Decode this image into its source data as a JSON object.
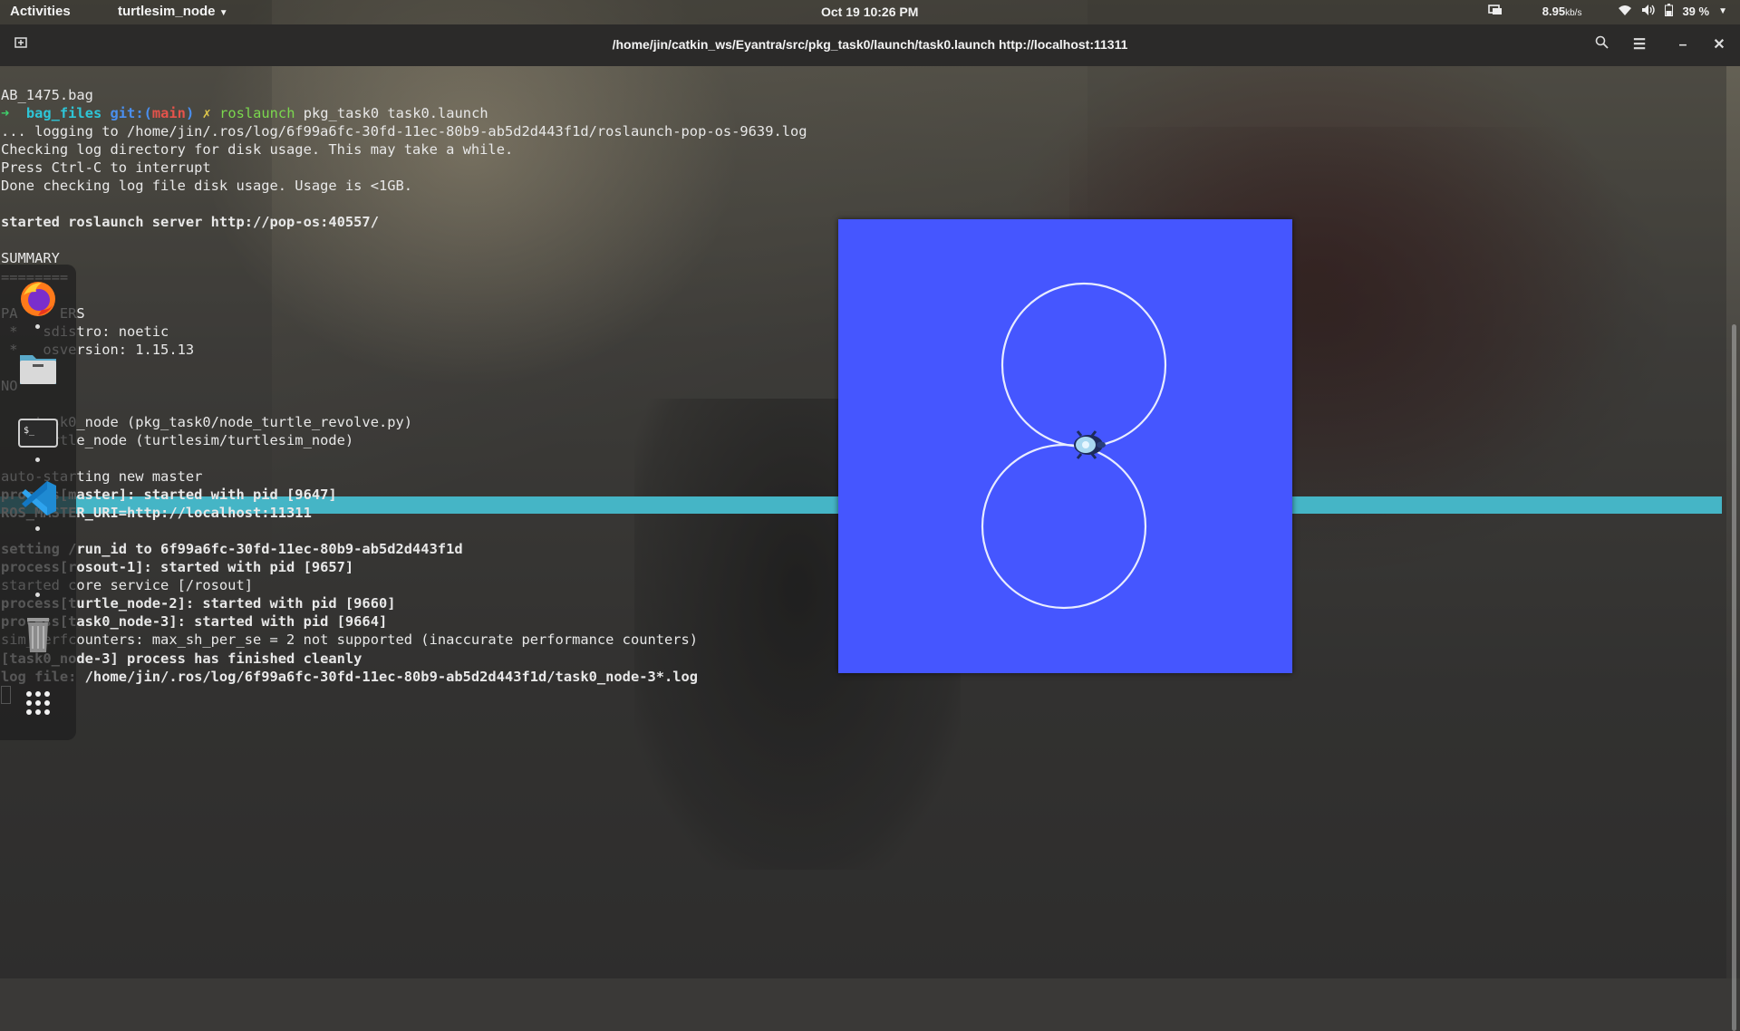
{
  "topbar": {
    "activities": "Activities",
    "app_menu": "turtlesim_node",
    "clock": "Oct 19  10:26 PM",
    "net_speed": "8.95",
    "net_unit": "kb/s",
    "battery": "39 %"
  },
  "terminal": {
    "title": "/home/jin/catkin_ws/Eyantra/src/pkg_task0/launch/task0.launch http://localhost:11311",
    "prompt": {
      "arrow": "➜",
      "dir": "bag_files",
      "git": "git:(",
      "branch": "main",
      "git_close": ")",
      "dirty": "✗",
      "command": "roslaunch",
      "args": "pkg_task0 task0.launch"
    },
    "lines": {
      "l0": "AB_1475.bag",
      "l2": "... logging to /home/jin/.ros/log/6f99a6fc-30fd-11ec-80b9-ab5d2d443f1d/roslaunch-pop-os-9639.log",
      "l3": "Checking log directory for disk usage. This may take a while.",
      "l4": "Press Ctrl-C to interrupt",
      "l5": "Done checking log file disk usage. Usage is <1GB.",
      "l7": "started roslaunch server http://pop-os:40557/",
      "l9": "SUMMARY",
      "l10": "========",
      "l12": "PA     ERS",
      "l13": " *   sdistro: noetic",
      "l14": " *   osversion: 1.15.13",
      "l16": "NO",
      "l18": "    task0_node (pkg_task0/node_turtle_revolve.py)",
      "l19": "    turtle_node (turtlesim/turtlesim_node)",
      "l21": "auto-starting new master",
      "l22": "process[master]: started with pid [9647]",
      "l23": "ROS_MASTER_URI=http://localhost:11311",
      "l25": "setting /run_id to 6f99a6fc-30fd-11ec-80b9-ab5d2d443f1d",
      "l26": "process[rosout-1]: started with pid [9657]",
      "l27": "started core service [/rosout]",
      "l28": "process[turtle_node-2]: started with pid [9660]",
      "l29": "process[task0_node-3]: started with pid [9664]",
      "l30": "sim_perfcounters: max_sh_per_se = 2 not supported (inaccurate performance counters)",
      "l31": "[task0_node-3] process has finished cleanly",
      "l32": "log file: /home/jin/.ros/log/6f99a6fc-30fd-11ec-80b9-ab5d2d443f1d/task0_node-3*.log"
    }
  },
  "dock_apps": [
    "firefox-icon",
    "files-icon",
    "terminal-icon",
    "vscode-icon",
    "trash-icon",
    "app-grid-icon"
  ],
  "colors": {
    "turtlesim_background": "#4556ff",
    "terminal_highlight": "#45b5c6"
  }
}
